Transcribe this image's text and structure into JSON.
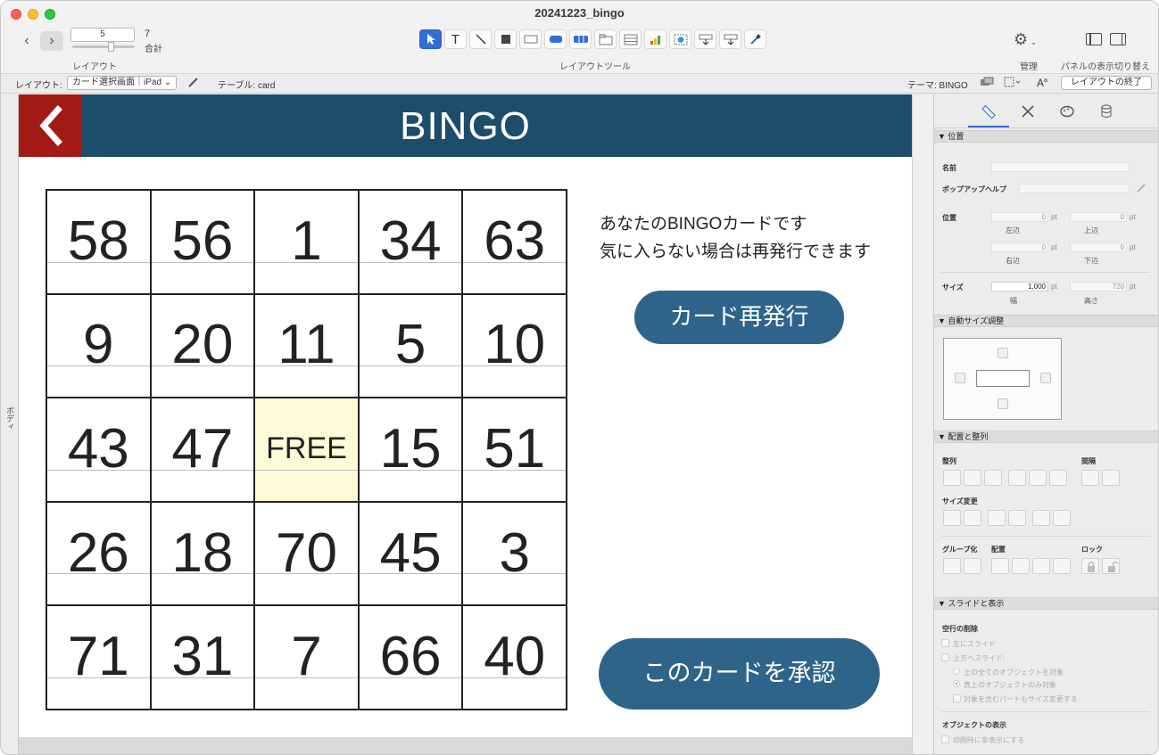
{
  "window": {
    "title": "20241223_bingo"
  },
  "toolbar": {
    "page_number": "5",
    "page_total": "7",
    "page_total_label": "合計",
    "layout_label": "レイアウト",
    "layout_tools_label": "レイアウトツール",
    "manage_label": "管理",
    "panel_toggle_label": "パネルの表示切り替え",
    "tools": [
      "pointer-tool",
      "text-tool",
      "line-tool",
      "shape-tool",
      "field-tool",
      "button-tool",
      "button-bar-tool",
      "popover-tool",
      "tab-control-tool",
      "portal-tool",
      "chart-tool",
      "web-viewer-tool",
      "insert-field-tool",
      "insert-part-tool",
      "format-painter-tool"
    ]
  },
  "layoutbar": {
    "layout_label": "レイアウト:",
    "layout_value": "カード選択画面｜iPad",
    "table_label": "テーブル: card",
    "theme_label": "テーマ: BINGO",
    "exit_button": "レイアウトの終了"
  },
  "canvas": {
    "body_part_label": "ボディ",
    "header_title": "BINGO",
    "message_line1": "あなたのBINGOカードです",
    "message_line2": "気に入らない場合は再発行できます",
    "reissue_button": "カード再発行",
    "approve_button": "このカードを承認",
    "free_label": "FREE",
    "card": [
      [
        "58",
        "56",
        "1",
        "34",
        "63"
      ],
      [
        "9",
        "20",
        "11",
        "5",
        "10"
      ],
      [
        "43",
        "47",
        "FREE",
        "15",
        "51"
      ],
      [
        "26",
        "18",
        "70",
        "45",
        "3"
      ],
      [
        "71",
        "31",
        "7",
        "66",
        "40"
      ]
    ],
    "colors": {
      "header": "#1c4d6b",
      "back_button": "#a11a15",
      "pill": "#2f648a",
      "free_cell": "#fefbd8"
    }
  },
  "inspector": {
    "section_position": "▼ 位置",
    "name_label": "名前",
    "popup_help_label": "ポップアップヘルプ",
    "position_label": "位置",
    "left_value": "0",
    "top_value": "0",
    "right_value": "0",
    "bottom_value": "0",
    "unit_pt": "pt",
    "left_label": "左辺",
    "top_label": "上辺",
    "right_label": "右辺",
    "bottom_label": "下辺",
    "size_label": "サイズ",
    "width_value": "1,000",
    "height_value": "720",
    "width_label": "幅",
    "height_label": "高さ",
    "section_autosize": "▼ 自動サイズ調整",
    "section_arrange": "▼ 配置と整列",
    "align_label": "整列",
    "spacing_label": "間隔",
    "resize_label": "サイズ変更",
    "group_label": "グループ化",
    "arrange_label": "配置",
    "lock_label": "ロック",
    "section_slide": "▼ スライドと表示",
    "remove_space_label": "空行の削除",
    "slide_left": "左にスライド",
    "slide_up": "上方へスライド:",
    "slide_all_above": "上の全てのオブジェクトを対象",
    "slide_directly_above": "真上のオブジェクトのみ対象",
    "slide_resize_part": "対象を含むパートもサイズ変更する",
    "object_display_label": "オブジェクトの表示",
    "hide_when_printing": "印刷時に非表示にする"
  }
}
